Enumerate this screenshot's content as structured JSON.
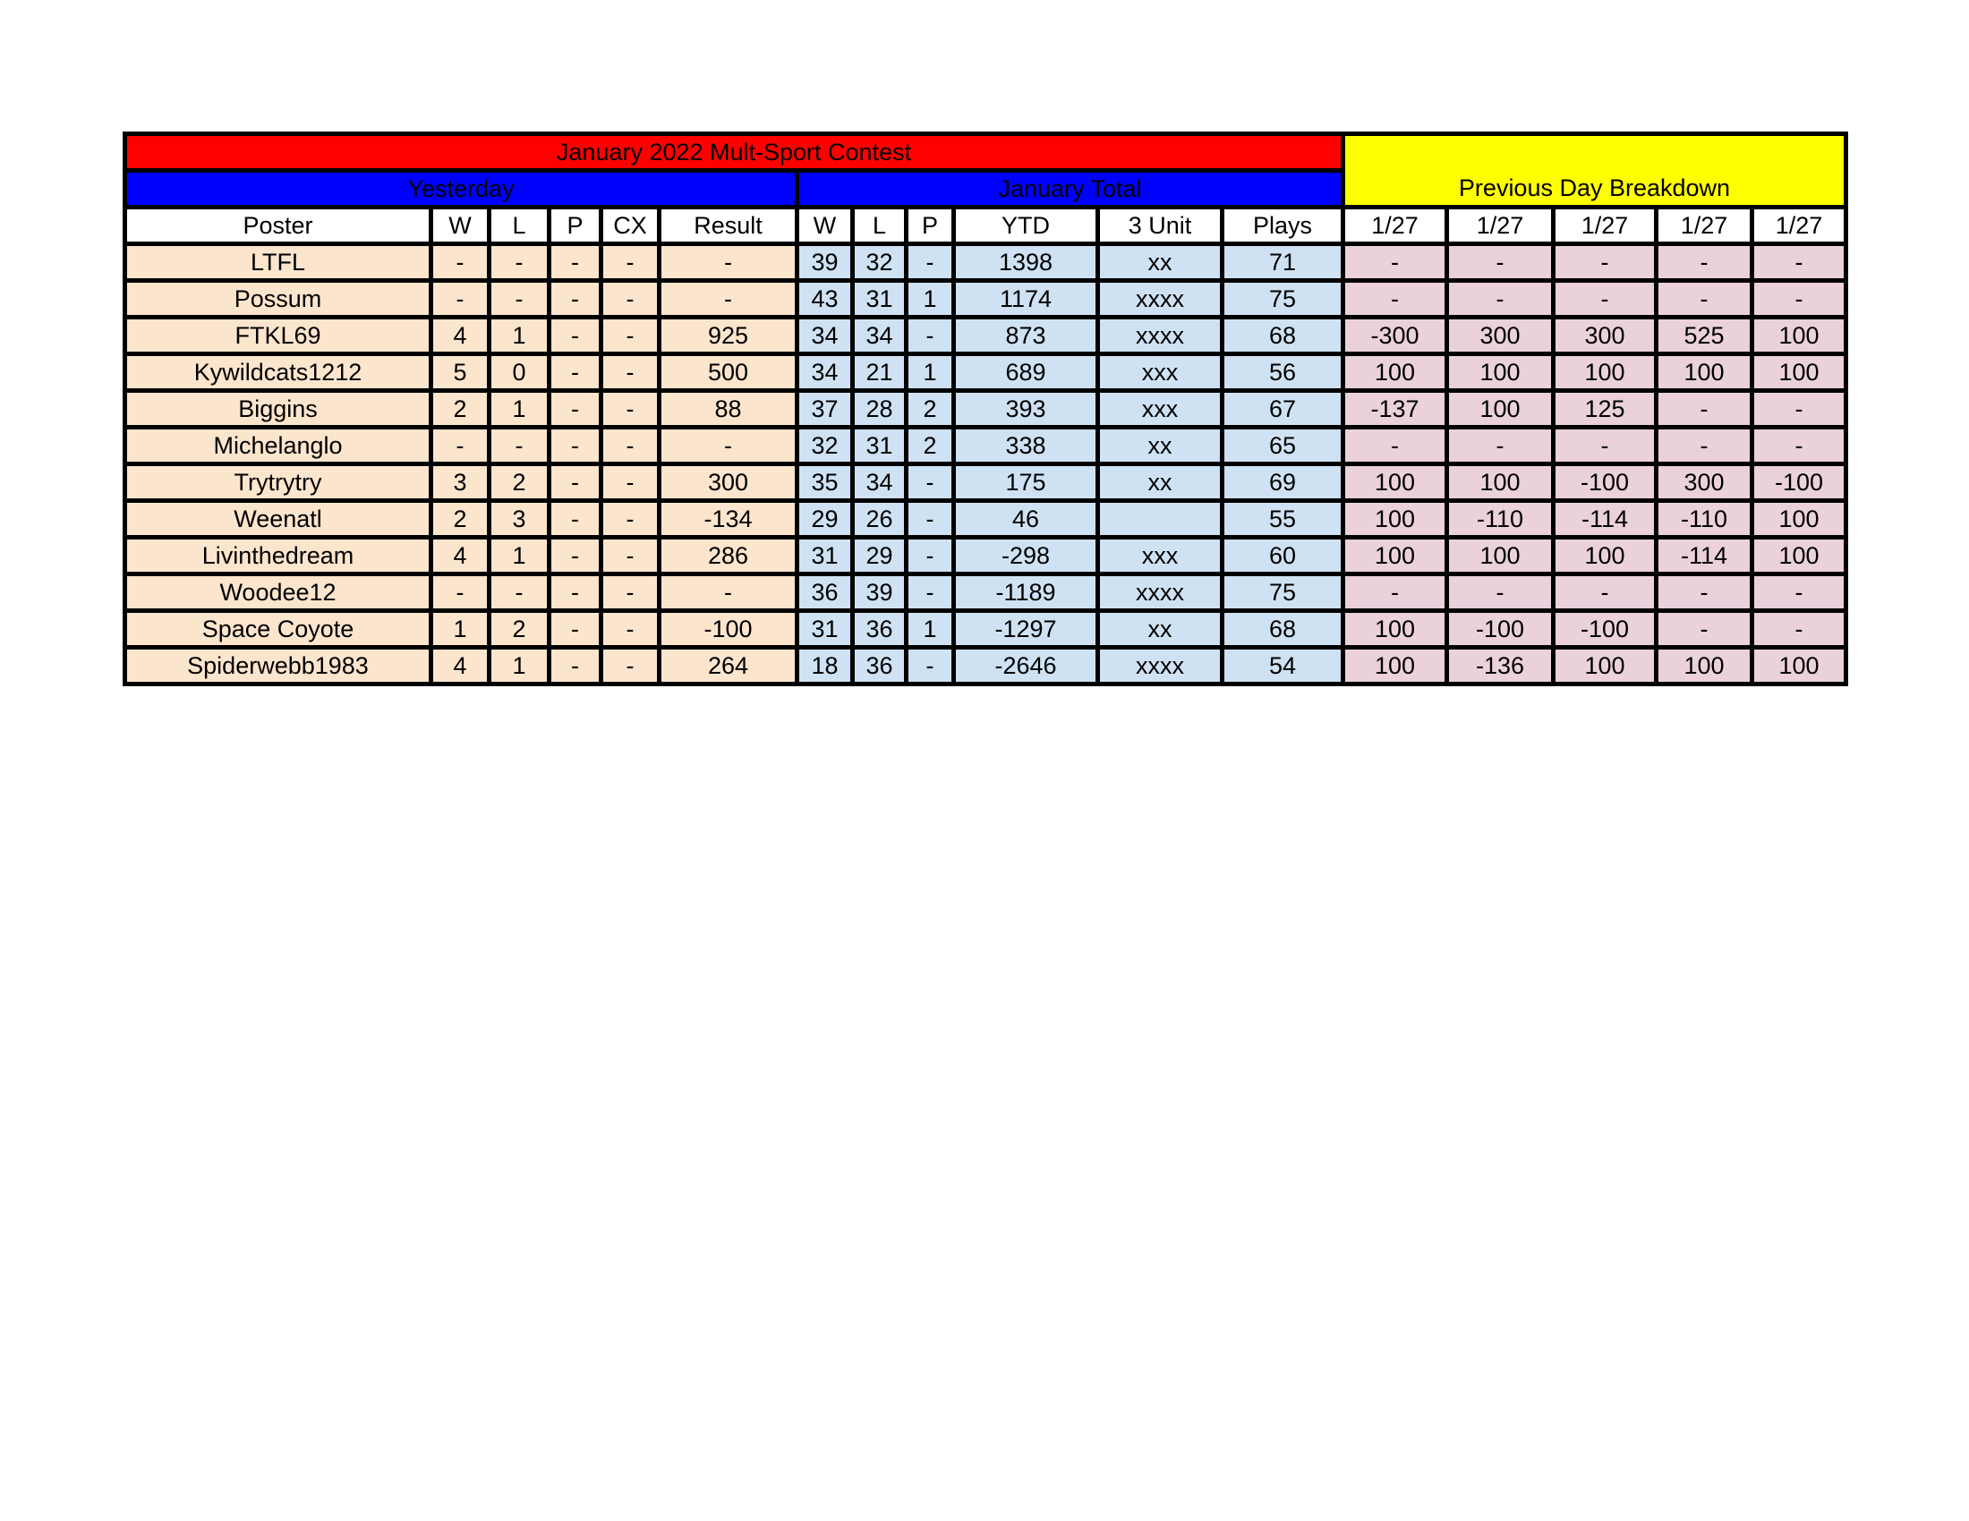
{
  "title": "January 2022 Mult-Sport Contest",
  "sections": {
    "yesterday": "Yesterday",
    "january_total": "January Total",
    "previous_day": "Previous Day Breakdown"
  },
  "columns": {
    "yesterday": [
      "Poster",
      "W",
      "L",
      "P",
      "CX",
      "Result"
    ],
    "january_total": [
      "W",
      "L",
      "P",
      "YTD",
      "3 Unit",
      "Plays"
    ],
    "previous_day": [
      "1/27",
      "1/27",
      "1/27",
      "1/27",
      "1/27"
    ]
  },
  "colors": {
    "title_bg": "#ff0000",
    "section_blue": "#0000ff",
    "section_yellow": "#ffff00",
    "yesterday_fill": "#fce5cd",
    "total_fill": "#cfe2f3",
    "breakdown_fill": "#ead1dc"
  },
  "rows": [
    {
      "poster": "LTFL",
      "y": [
        "-",
        "-",
        "-",
        "-",
        "-"
      ],
      "t": [
        "39",
        "32",
        "-",
        "1398",
        "xx",
        "71"
      ],
      "d": [
        "-",
        "-",
        "-",
        "-",
        "-"
      ]
    },
    {
      "poster": "Possum",
      "y": [
        "-",
        "-",
        "-",
        "-",
        "-"
      ],
      "t": [
        "43",
        "31",
        "1",
        "1174",
        "xxxx",
        "75"
      ],
      "d": [
        "-",
        "-",
        "-",
        "-",
        "-"
      ]
    },
    {
      "poster": "FTKL69",
      "y": [
        "4",
        "1",
        "-",
        "-",
        "925"
      ],
      "t": [
        "34",
        "34",
        "-",
        "873",
        "xxxx",
        "68"
      ],
      "d": [
        "-300",
        "300",
        "300",
        "525",
        "100"
      ]
    },
    {
      "poster": "Kywildcats1212",
      "y": [
        "5",
        "0",
        "-",
        "-",
        "500"
      ],
      "t": [
        "34",
        "21",
        "1",
        "689",
        "xxx",
        "56"
      ],
      "d": [
        "100",
        "100",
        "100",
        "100",
        "100"
      ]
    },
    {
      "poster": "Biggins",
      "y": [
        "2",
        "1",
        "-",
        "-",
        "88"
      ],
      "t": [
        "37",
        "28",
        "2",
        "393",
        "xxx",
        "67"
      ],
      "d": [
        "-137",
        "100",
        "125",
        "-",
        "-"
      ]
    },
    {
      "poster": "Michelanglo",
      "y": [
        "-",
        "-",
        "-",
        "-",
        "-"
      ],
      "t": [
        "32",
        "31",
        "2",
        "338",
        "xx",
        "65"
      ],
      "d": [
        "-",
        "-",
        "-",
        "-",
        "-"
      ]
    },
    {
      "poster": "Trytrytry",
      "y": [
        "3",
        "2",
        "-",
        "-",
        "300"
      ],
      "t": [
        "35",
        "34",
        "-",
        "175",
        "xx",
        "69"
      ],
      "d": [
        "100",
        "100",
        "-100",
        "300",
        "-100"
      ]
    },
    {
      "poster": "Weenatl",
      "y": [
        "2",
        "3",
        "-",
        "-",
        "-134"
      ],
      "t": [
        "29",
        "26",
        "-",
        "46",
        "",
        "55"
      ],
      "d": [
        "100",
        "-110",
        "-114",
        "-110",
        "100"
      ]
    },
    {
      "poster": "Livinthedream",
      "y": [
        "4",
        "1",
        "-",
        "-",
        "286"
      ],
      "t": [
        "31",
        "29",
        "-",
        "-298",
        "xxx",
        "60"
      ],
      "d": [
        "100",
        "100",
        "100",
        "-114",
        "100"
      ]
    },
    {
      "poster": "Woodee12",
      "y": [
        "-",
        "-",
        "-",
        "-",
        "-"
      ],
      "t": [
        "36",
        "39",
        "-",
        "-1189",
        "xxxx",
        "75"
      ],
      "d": [
        "-",
        "-",
        "-",
        "-",
        "-"
      ]
    },
    {
      "poster": "Space Coyote",
      "y": [
        "1",
        "2",
        "-",
        "-",
        "-100"
      ],
      "t": [
        "31",
        "36",
        "1",
        "-1297",
        "xx",
        "68"
      ],
      "d": [
        "100",
        "-100",
        "-100",
        "-",
        "-"
      ]
    },
    {
      "poster": "Spiderwebb1983",
      "y": [
        "4",
        "1",
        "-",
        "-",
        "264"
      ],
      "t": [
        "18",
        "36",
        "-",
        "-2646",
        "xxxx",
        "54"
      ],
      "d": [
        "100",
        "-136",
        "100",
        "100",
        "100"
      ]
    }
  ]
}
